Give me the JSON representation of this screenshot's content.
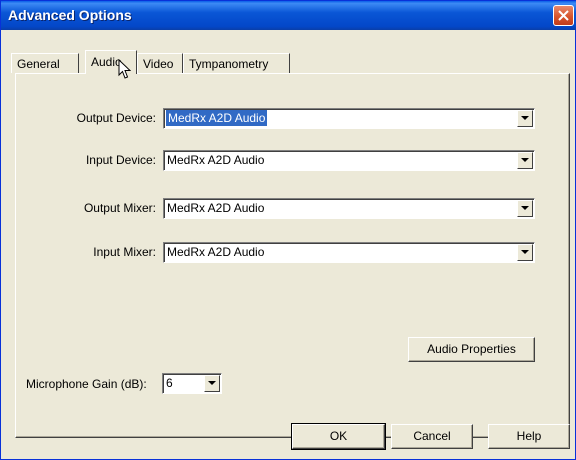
{
  "window": {
    "title": "Advanced Options"
  },
  "tabs": [
    {
      "label": "General",
      "active": false
    },
    {
      "label": "Audio",
      "active": true
    },
    {
      "label": "Video",
      "active": false
    },
    {
      "label": "Tympanometry",
      "active": false
    }
  ],
  "audio": {
    "output_device": {
      "label": "Output Device:",
      "value": "MedRx A2D Audio",
      "focused": true
    },
    "input_device": {
      "label": "Input Device:",
      "value": "MedRx A2D Audio"
    },
    "output_mixer": {
      "label": "Output Mixer:",
      "value": "MedRx A2D Audio"
    },
    "input_mixer": {
      "label": "Input Mixer:",
      "value": "MedRx A2D Audio"
    },
    "audio_properties_label": "Audio Properties",
    "mic_gain": {
      "label": "Microphone Gain (dB):",
      "value": "6"
    }
  },
  "footer": {
    "ok_label": "OK",
    "cancel_label": "Cancel",
    "help_label": "Help"
  },
  "icons": {
    "close": "close-icon",
    "dropdown": "chevron-down-icon",
    "cursor": "mouse-pointer-icon"
  },
  "colors": {
    "titlebar": "#0a56d6",
    "close_button": "#d8552d",
    "selection": "#316ac5",
    "face": "#ece9d8"
  }
}
